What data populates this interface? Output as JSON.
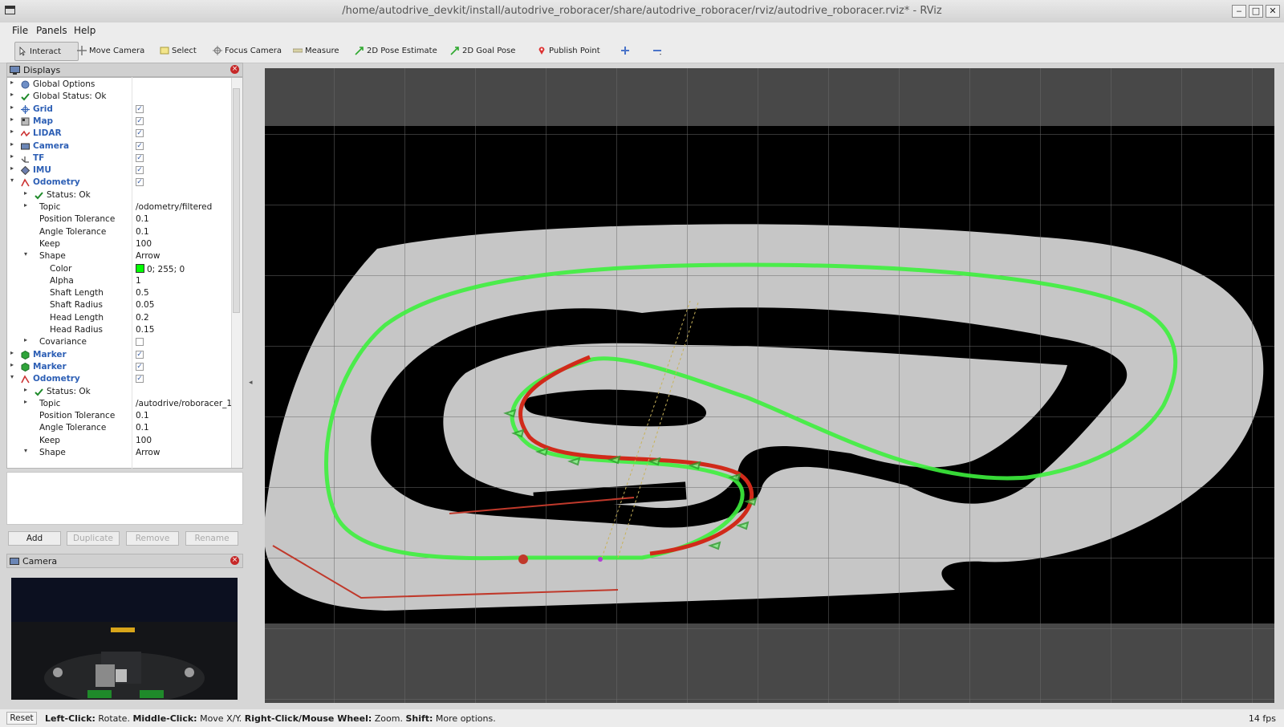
{
  "window": {
    "title": "/home/autodrive_devkit/install/autodrive_roboracer/share/autodrive_roboracer/rviz/autodrive_roboracer.rviz* - RViz",
    "controls": [
      "‒",
      "□",
      "✕"
    ]
  },
  "menu": [
    "File",
    "Panels",
    "Help"
  ],
  "toolbar": {
    "tools": [
      {
        "label": "Interact",
        "icon": "cursor-icon"
      },
      {
        "label": "Move Camera",
        "icon": "move-icon"
      },
      {
        "label": "Select",
        "icon": "select-icon"
      },
      {
        "label": "Focus Camera",
        "icon": "focus-icon"
      },
      {
        "label": "Measure",
        "icon": "ruler-icon"
      },
      {
        "label": "2D Pose Estimate",
        "icon": "green-arrow-icon"
      },
      {
        "label": "2D Goal Pose",
        "icon": "green-arrow-icon"
      },
      {
        "label": "Publish Point",
        "icon": "map-pin-icon"
      }
    ],
    "add_icon": "plus-icon",
    "remove_icon": "minus-icon"
  },
  "displays_panel": {
    "title": "Displays",
    "close": "×",
    "rows": [
      {
        "indent": 0,
        "arrow": "▸",
        "icon": "globe-icon",
        "label": "Global Options",
        "value": "",
        "check": "",
        "blue": false
      },
      {
        "indent": 0,
        "arrow": "▸",
        "icon": "check-icon",
        "label": "Global Status: Ok",
        "value": "",
        "check": "",
        "blue": false
      },
      {
        "indent": 0,
        "arrow": "▸",
        "icon": "grid-icon",
        "label": "Grid",
        "value": "",
        "check": "✓",
        "blue": true
      },
      {
        "indent": 0,
        "arrow": "▸",
        "icon": "map-icon",
        "label": "Map",
        "value": "",
        "check": "✓",
        "blue": true
      },
      {
        "indent": 0,
        "arrow": "▸",
        "icon": "laser-icon",
        "label": "LIDAR",
        "value": "",
        "check": "✓",
        "blue": true
      },
      {
        "indent": 0,
        "arrow": "▸",
        "icon": "camera-icon",
        "label": "Camera",
        "value": "",
        "check": "✓",
        "blue": true
      },
      {
        "indent": 0,
        "arrow": "▸",
        "icon": "tf-icon",
        "label": "TF",
        "value": "",
        "check": "✓",
        "blue": true
      },
      {
        "indent": 0,
        "arrow": "▸",
        "icon": "imu-icon",
        "label": "IMU",
        "value": "",
        "check": "✓",
        "blue": true
      },
      {
        "indent": 0,
        "arrow": "▾",
        "icon": "odometry-icon",
        "label": "Odometry",
        "value": "",
        "check": "✓",
        "blue": true
      },
      {
        "indent": 1,
        "arrow": "▸",
        "icon": "check-icon",
        "label": "Status: Ok",
        "value": "",
        "check": "",
        "blue": false
      },
      {
        "indent": 1,
        "arrow": "▸",
        "icon": "",
        "label": "Topic",
        "value": "/odometry/filtered",
        "check": "",
        "blue": false
      },
      {
        "indent": 1,
        "arrow": "",
        "icon": "",
        "label": "Position Tolerance",
        "value": "0.1",
        "check": "",
        "blue": false
      },
      {
        "indent": 1,
        "arrow": "",
        "icon": "",
        "label": "Angle Tolerance",
        "value": "0.1",
        "check": "",
        "blue": false
      },
      {
        "indent": 1,
        "arrow": "",
        "icon": "",
        "label": "Keep",
        "value": "100",
        "check": "",
        "blue": false
      },
      {
        "indent": 1,
        "arrow": "▾",
        "icon": "",
        "label": "Shape",
        "value": "Arrow",
        "check": "",
        "blue": false
      },
      {
        "indent": 2,
        "arrow": "",
        "icon": "",
        "label": "Color",
        "value": "0; 255; 0",
        "swatch": "#00ff00",
        "check": "",
        "blue": false
      },
      {
        "indent": 2,
        "arrow": "",
        "icon": "",
        "label": "Alpha",
        "value": "1",
        "check": "",
        "blue": false
      },
      {
        "indent": 2,
        "arrow": "",
        "icon": "",
        "label": "Shaft Length",
        "value": "0.5",
        "check": "",
        "blue": false
      },
      {
        "indent": 2,
        "arrow": "",
        "icon": "",
        "label": "Shaft Radius",
        "value": "0.05",
        "check": "",
        "blue": false
      },
      {
        "indent": 2,
        "arrow": "",
        "icon": "",
        "label": "Head Length",
        "value": "0.2",
        "check": "",
        "blue": false
      },
      {
        "indent": 2,
        "arrow": "",
        "icon": "",
        "label": "Head Radius",
        "value": "0.15",
        "check": "",
        "blue": false
      },
      {
        "indent": 1,
        "arrow": "▸",
        "icon": "",
        "label": "Covariance",
        "value": "",
        "check": " ",
        "blue": false
      },
      {
        "indent": 0,
        "arrow": "▸",
        "icon": "marker-icon",
        "label": "Marker",
        "value": "",
        "check": "✓",
        "blue": true
      },
      {
        "indent": 0,
        "arrow": "▸",
        "icon": "marker-icon",
        "label": "Marker",
        "value": "",
        "check": "✓",
        "blue": true
      },
      {
        "indent": 0,
        "arrow": "▾",
        "icon": "odometry-icon",
        "label": "Odometry",
        "value": "",
        "check": "✓",
        "blue": true
      },
      {
        "indent": 1,
        "arrow": "▸",
        "icon": "check-icon",
        "label": "Status: Ok",
        "value": "",
        "check": "",
        "blue": false
      },
      {
        "indent": 1,
        "arrow": "▸",
        "icon": "",
        "label": "Topic",
        "value": "/autodrive/roboracer_1_",
        "check": "",
        "blue": false
      },
      {
        "indent": 1,
        "arrow": "",
        "icon": "",
        "label": "Position Tolerance",
        "value": "0.1",
        "check": "",
        "blue": false
      },
      {
        "indent": 1,
        "arrow": "",
        "icon": "",
        "label": "Angle Tolerance",
        "value": "0.1",
        "check": "",
        "blue": false
      },
      {
        "indent": 1,
        "arrow": "",
        "icon": "",
        "label": "Keep",
        "value": "100",
        "check": "",
        "blue": false
      },
      {
        "indent": 1,
        "arrow": "▾",
        "icon": "",
        "label": "Shape",
        "value": "Arrow",
        "check": "",
        "blue": false
      }
    ],
    "buttons": [
      {
        "label": "Add",
        "enabled": true
      },
      {
        "label": "Duplicate",
        "enabled": false
      },
      {
        "label": "Remove",
        "enabled": false
      },
      {
        "label": "Rename",
        "enabled": false
      }
    ]
  },
  "camera_panel": {
    "title": "Camera",
    "close": "×"
  },
  "statusbar": {
    "reset": "Reset",
    "hint": [
      {
        "b": "Left-Click:",
        "t": " Rotate. "
      },
      {
        "b": "Middle-Click:",
        "t": " Move X/Y. "
      },
      {
        "b": "Right-Click/Mouse Wheel:",
        "t": " Zoom. "
      },
      {
        "b": "Shift:",
        "t": " More options."
      }
    ],
    "fps": "14 fps"
  },
  "colors": {
    "track": "#c6c6c6",
    "map_unknown": "#000000",
    "background": "#484848",
    "path_green": "#3df03d",
    "path_red": "#d12a1a"
  }
}
